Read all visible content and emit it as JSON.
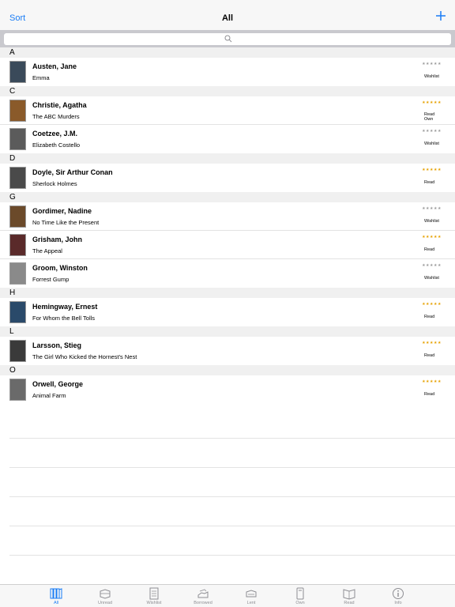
{
  "nav": {
    "sort_label": "Sort",
    "title": "All"
  },
  "search": {
    "placeholder": ""
  },
  "colors": {
    "accent": "#1a7cf5",
    "star_filled": "#e6a100",
    "star_empty": "#9a9a9a"
  },
  "sections": [
    {
      "letter": "A",
      "books": [
        {
          "author": "Austen, Jane",
          "title": "Emma",
          "stars": "★★★★★",
          "rating": 0,
          "status": [
            "Wishlist"
          ],
          "cover": "#3a4a5a"
        }
      ]
    },
    {
      "letter": "C",
      "books": [
        {
          "author": "Christie, Agatha",
          "title": "The ABC Murders",
          "stars": "★★★★★",
          "rating": 5,
          "status": [
            "Read",
            "Own"
          ],
          "cover": "#8a5a2a"
        },
        {
          "author": "Coetzee, J.M.",
          "title": "Elizabeth Costello",
          "stars": "★★★★★",
          "rating": 0,
          "status": [
            "Wishlist"
          ],
          "cover": "#5b5b5b"
        }
      ]
    },
    {
      "letter": "D",
      "books": [
        {
          "author": "Doyle, Sir Arthur Conan",
          "title": "Sherlock Holmes",
          "stars": "★★★★★",
          "rating": 5,
          "status": [
            "Read"
          ],
          "cover": "#4a4a4a"
        }
      ]
    },
    {
      "letter": "G",
      "books": [
        {
          "author": "Gordimer, Nadine",
          "title": "No Time Like the Present",
          "stars": "★★★★★",
          "rating": 0,
          "status": [
            "Wishlist"
          ],
          "cover": "#6b4a2a"
        },
        {
          "author": "Grisham, John",
          "title": "The Appeal",
          "stars": "★★★★★",
          "rating": 5,
          "status": [
            "Read"
          ],
          "cover": "#5a2a2a"
        },
        {
          "author": "Groom, Winston",
          "title": "Forrest Gump",
          "stars": "★★★★★",
          "rating": 0,
          "status": [
            "Wishlist"
          ],
          "cover": "#8a8a8a"
        }
      ]
    },
    {
      "letter": "H",
      "books": [
        {
          "author": "Hemingway, Ernest",
          "title": "For Whom the Bell Tolls",
          "stars": "★★★★★",
          "rating": 5,
          "status": [
            "Read"
          ],
          "cover": "#2a4a6a"
        }
      ]
    },
    {
      "letter": "L",
      "books": [
        {
          "author": "Larsson, Stieg",
          "title": "The Girl Who Kicked the Hornest's Nest",
          "stars": "★★★★★",
          "rating": 5,
          "status": [
            "Read"
          ],
          "cover": "#3a3a3a"
        }
      ]
    },
    {
      "letter": "O",
      "books": [
        {
          "author": "Orwell, George",
          "title": "Animal Farm",
          "stars": "★★★★★",
          "rating": 5,
          "status": [
            "Read"
          ],
          "cover": "#6a6a6a"
        }
      ]
    }
  ],
  "tabs": [
    {
      "label": "All",
      "icon": "library-icon",
      "active": true
    },
    {
      "label": "Unread",
      "icon": "unread-icon",
      "active": false
    },
    {
      "label": "Wishlist",
      "icon": "wishlist-icon",
      "active": false
    },
    {
      "label": "Borrowed",
      "icon": "borrowed-icon",
      "active": false
    },
    {
      "label": "Lent",
      "icon": "lent-icon",
      "active": false
    },
    {
      "label": "Own",
      "icon": "own-icon",
      "active": false
    },
    {
      "label": "Read",
      "icon": "read-icon",
      "active": false
    },
    {
      "label": "Info",
      "icon": "info-icon",
      "active": false
    }
  ]
}
